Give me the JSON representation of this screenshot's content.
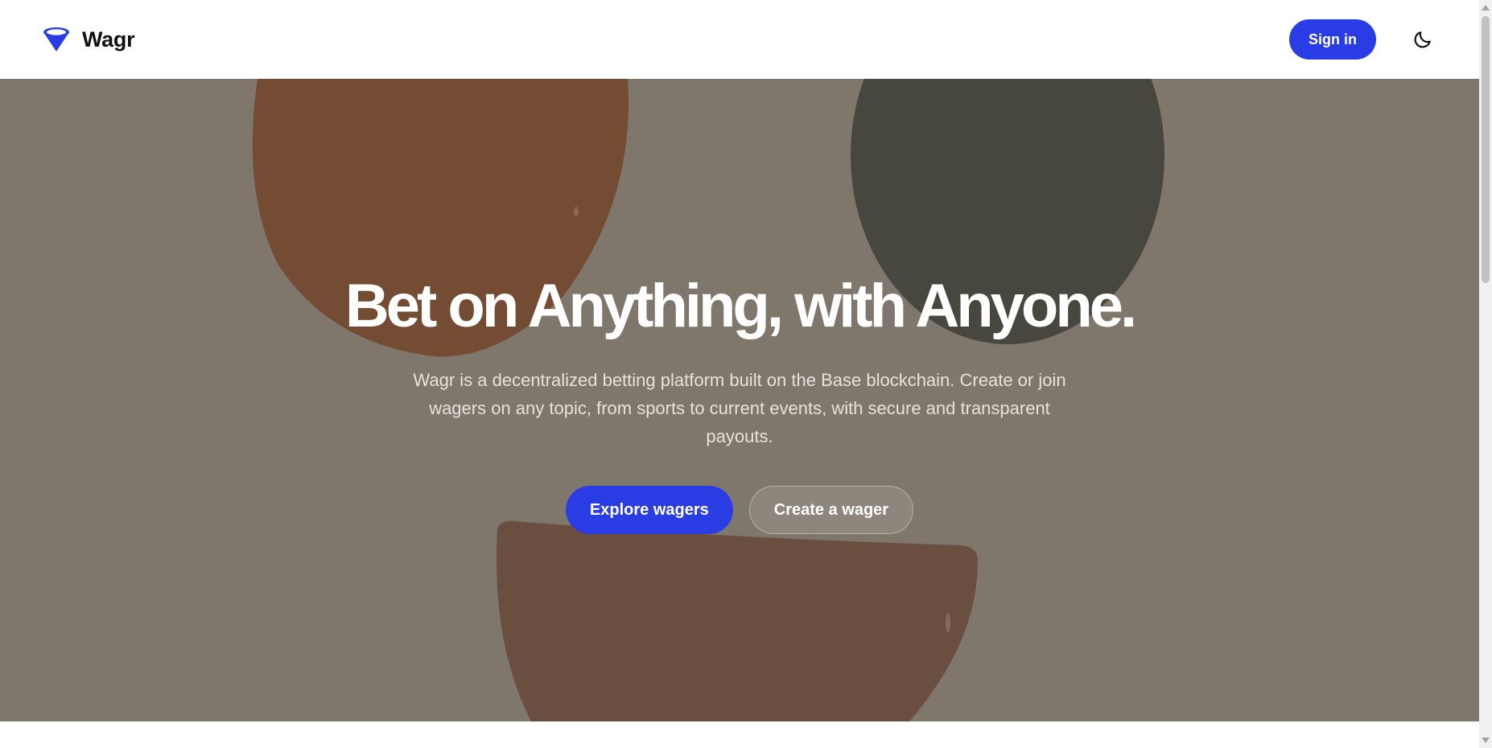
{
  "header": {
    "brand_name": "Wagr",
    "signin_label": "Sign in",
    "theme_toggle_icon": "moon-icon"
  },
  "hero": {
    "title": "Bet on Anything, with Anyone.",
    "description": "Wagr is a decentralized betting platform built on the Base blockchain. Create or join wagers on any topic, from sports to current events, with secure and transparent payouts.",
    "primary_action": "Explore wagers",
    "secondary_action": "Create a wager"
  },
  "colors": {
    "accent": "#2a3ce4",
    "hero_overlay": "#7f766c",
    "header_bg": "#ffffff"
  }
}
